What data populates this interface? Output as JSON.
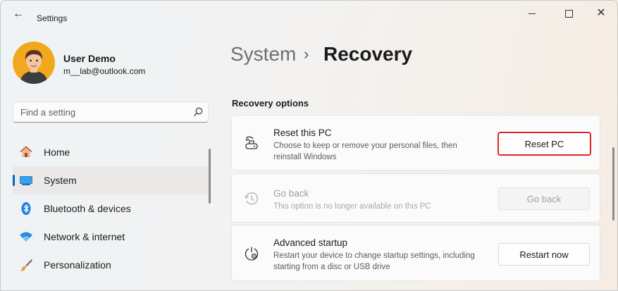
{
  "window": {
    "title": "Settings"
  },
  "user": {
    "name": "User Demo",
    "email": "m__lab@outlook.com"
  },
  "search": {
    "placeholder": "Find a setting",
    "value": ""
  },
  "sidebar": {
    "items": [
      {
        "label": "Home",
        "icon": "home-icon",
        "active": false
      },
      {
        "label": "System",
        "icon": "system-icon",
        "active": true
      },
      {
        "label": "Bluetooth & devices",
        "icon": "bluetooth-icon",
        "active": false
      },
      {
        "label": "Network & internet",
        "icon": "wifi-icon",
        "active": false
      },
      {
        "label": "Personalization",
        "icon": "brush-icon",
        "active": false
      }
    ]
  },
  "breadcrumb": {
    "parent": "System",
    "separator": "›",
    "current": "Recovery"
  },
  "main": {
    "section_title": "Recovery options",
    "options": [
      {
        "title": "Reset this PC",
        "description": "Choose to keep or remove your personal files, then reinstall Windows",
        "button": "Reset PC",
        "enabled": true,
        "icon": "reset-pc-icon"
      },
      {
        "title": "Go back",
        "description": "This option is no longer available on this PC",
        "button": "Go back",
        "enabled": false,
        "icon": "history-icon"
      },
      {
        "title": "Advanced startup",
        "description": "Restart your device to change startup settings, including starting from a disc or USB drive",
        "button": "Restart now",
        "enabled": true,
        "icon": "advanced-startup-icon"
      }
    ]
  },
  "colors": {
    "accent": "#0067c0",
    "highlight_border": "#d6282d"
  }
}
